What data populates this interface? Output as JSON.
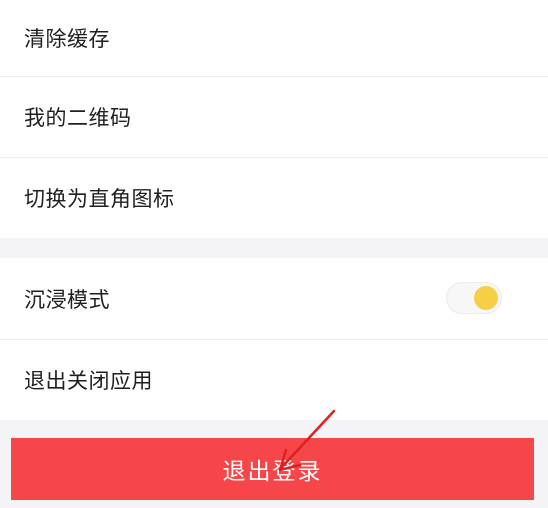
{
  "settings": {
    "group1": [
      {
        "label": "清除缓存"
      },
      {
        "label": "我的二维码"
      },
      {
        "label": "切换为直角图标"
      }
    ],
    "group2": {
      "immersive_label": "沉浸模式",
      "immersive_enabled": true,
      "exit_app_label": "退出关闭应用"
    },
    "logout_label": "退出登录"
  },
  "colors": {
    "accent_red": "#f64649",
    "toggle_knob": "#f6cf44",
    "annotation_arrow": "#e02020"
  }
}
